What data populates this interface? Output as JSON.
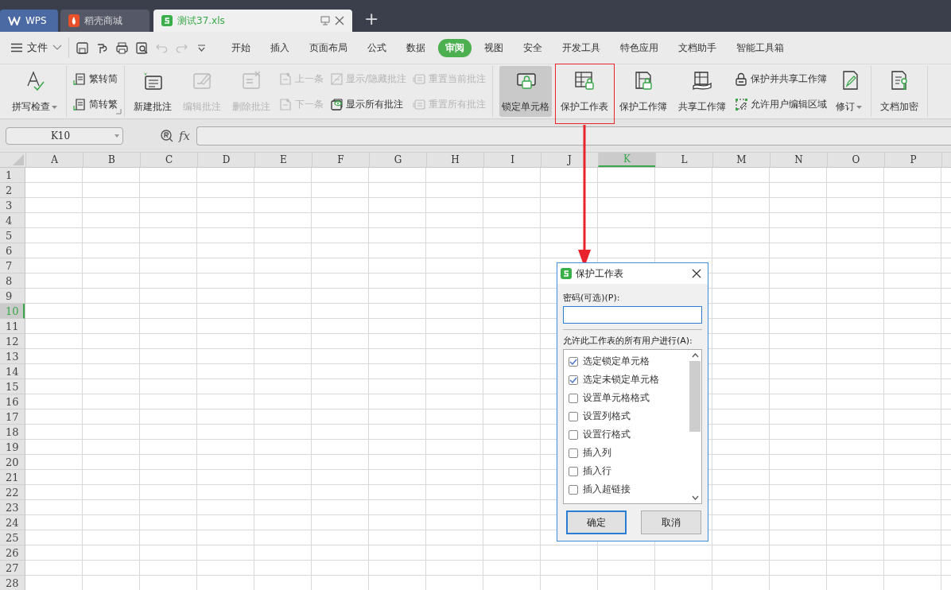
{
  "tabs": [
    {
      "label": "WPS",
      "kind": "home",
      "selected": false
    },
    {
      "label": "稻壳商城",
      "kind": "store",
      "selected": false
    },
    {
      "label": "测试37.xls",
      "kind": "sheet",
      "selected": true
    }
  ],
  "add_tab": "+",
  "menu": {
    "file": "文件",
    "items": [
      {
        "label": "开始",
        "selected": false
      },
      {
        "label": "插入",
        "selected": false
      },
      {
        "label": "页面布局",
        "selected": false
      },
      {
        "label": "公式",
        "selected": false
      },
      {
        "label": "数据",
        "selected": false
      },
      {
        "label": "审阅",
        "selected": true
      },
      {
        "label": "视图",
        "selected": false
      },
      {
        "label": "安全",
        "selected": false
      },
      {
        "label": "开发工具",
        "selected": false
      },
      {
        "label": "特色应用",
        "selected": false
      },
      {
        "label": "文档助手",
        "selected": false
      },
      {
        "label": "智能工具箱",
        "selected": false
      }
    ]
  },
  "ribbon": {
    "groups": [
      {
        "columns": [
          {
            "kind": "large",
            "buttons": [
              {
                "label": "拼写检查",
                "disabled": false,
                "pressed": false,
                "dropdown": true
              }
            ]
          }
        ]
      },
      {
        "launcher": true,
        "columns": [
          {
            "kind": "stack",
            "buttons": [
              {
                "label": "繁转简",
                "disabled": false,
                "pressed": false,
                "dropdown": false
              },
              {
                "label": "简转繁",
                "disabled": false,
                "pressed": false,
                "dropdown": false
              }
            ]
          }
        ]
      },
      {
        "columns": [
          {
            "kind": "large",
            "buttons": [
              {
                "label": "新建批注",
                "disabled": false,
                "pressed": false,
                "dropdown": false
              }
            ]
          },
          {
            "kind": "large",
            "buttons": [
              {
                "label": "编辑批注",
                "disabled": true,
                "pressed": false,
                "dropdown": false
              }
            ]
          },
          {
            "kind": "large",
            "buttons": [
              {
                "label": "删除批注",
                "disabled": true,
                "pressed": false,
                "dropdown": false
              }
            ]
          },
          {
            "kind": "stack",
            "buttons": [
              {
                "label": "上一条",
                "disabled": true,
                "pressed": false,
                "dropdown": false
              },
              {
                "label": "下一条",
                "disabled": true,
                "pressed": false,
                "dropdown": false
              }
            ]
          },
          {
            "kind": "stack",
            "buttons": [
              {
                "label": "显示/隐藏批注",
                "disabled": true,
                "pressed": false,
                "dropdown": false
              },
              {
                "label": "显示所有批注",
                "disabled": false,
                "pressed": false,
                "dropdown": false
              }
            ]
          },
          {
            "kind": "stack",
            "buttons": [
              {
                "label": "重置当前批注",
                "disabled": true,
                "pressed": false,
                "dropdown": false
              },
              {
                "label": "重置所有批注",
                "disabled": true,
                "pressed": false,
                "dropdown": false
              }
            ]
          }
        ]
      },
      {
        "columns": [
          {
            "kind": "large",
            "buttons": [
              {
                "label": "锁定单元格",
                "disabled": false,
                "pressed": true,
                "dropdown": false
              }
            ]
          },
          {
            "kind": "large",
            "buttons": [
              {
                "label": "保护工作表",
                "disabled": false,
                "pressed": false,
                "dropdown": false
              }
            ]
          },
          {
            "kind": "large",
            "buttons": [
              {
                "label": "保护工作簿",
                "disabled": false,
                "pressed": false,
                "dropdown": false
              }
            ]
          },
          {
            "kind": "large",
            "buttons": [
              {
                "label": "共享工作簿",
                "disabled": false,
                "pressed": false,
                "dropdown": false
              }
            ]
          },
          {
            "kind": "stack",
            "buttons": [
              {
                "label": "保护并共享工作簿",
                "disabled": false,
                "pressed": false,
                "dropdown": false
              },
              {
                "label": "允许用户编辑区域",
                "disabled": false,
                "pressed": false,
                "dropdown": false
              }
            ]
          },
          {
            "kind": "large",
            "buttons": [
              {
                "label": "修订",
                "disabled": false,
                "pressed": false,
                "dropdown": true
              }
            ]
          }
        ]
      },
      {
        "columns": [
          {
            "kind": "large",
            "buttons": [
              {
                "label": "文档加密",
                "disabled": false,
                "pressed": false,
                "dropdown": false
              }
            ]
          }
        ]
      }
    ]
  },
  "formula_bar": {
    "name_box": "K10",
    "fx": "fx"
  },
  "sheet": {
    "columns": [
      {
        "label": "A",
        "selected": false
      },
      {
        "label": "B",
        "selected": false
      },
      {
        "label": "C",
        "selected": false
      },
      {
        "label": "D",
        "selected": false
      },
      {
        "label": "E",
        "selected": false
      },
      {
        "label": "F",
        "selected": false
      },
      {
        "label": "G",
        "selected": false
      },
      {
        "label": "H",
        "selected": false
      },
      {
        "label": "I",
        "selected": false
      },
      {
        "label": "J",
        "selected": false
      },
      {
        "label": "K",
        "selected": true
      },
      {
        "label": "L",
        "selected": false
      },
      {
        "label": "M",
        "selected": false
      },
      {
        "label": "N",
        "selected": false
      },
      {
        "label": "O",
        "selected": false
      },
      {
        "label": "P",
        "selected": false
      }
    ],
    "rows": [
      {
        "label": "1",
        "selected": false
      },
      {
        "label": "2",
        "selected": false
      },
      {
        "label": "3",
        "selected": false
      },
      {
        "label": "4",
        "selected": false
      },
      {
        "label": "5",
        "selected": false
      },
      {
        "label": "6",
        "selected": false
      },
      {
        "label": "7",
        "selected": false
      },
      {
        "label": "8",
        "selected": false
      },
      {
        "label": "9",
        "selected": false
      },
      {
        "label": "10",
        "selected": true
      },
      {
        "label": "11",
        "selected": false
      },
      {
        "label": "12",
        "selected": false
      },
      {
        "label": "13",
        "selected": false
      },
      {
        "label": "14",
        "selected": false
      },
      {
        "label": "15",
        "selected": false
      },
      {
        "label": "16",
        "selected": false
      },
      {
        "label": "17",
        "selected": false
      },
      {
        "label": "18",
        "selected": false
      },
      {
        "label": "19",
        "selected": false
      },
      {
        "label": "20",
        "selected": false
      },
      {
        "label": "21",
        "selected": false
      },
      {
        "label": "22",
        "selected": false
      },
      {
        "label": "23",
        "selected": false
      },
      {
        "label": "24",
        "selected": false
      },
      {
        "label": "25",
        "selected": false
      },
      {
        "label": "26",
        "selected": false
      },
      {
        "label": "27",
        "selected": false
      },
      {
        "label": "28",
        "selected": false
      }
    ]
  },
  "dialog": {
    "title": "保护工作表",
    "password_label": "密码(可选)(P):",
    "allow_label": "允许此工作表的所有用户进行(A):",
    "options": [
      {
        "label": "选定锁定单元格",
        "checked": true
      },
      {
        "label": "选定未锁定单元格",
        "checked": true
      },
      {
        "label": "设置单元格格式",
        "checked": false
      },
      {
        "label": "设置列格式",
        "checked": false
      },
      {
        "label": "设置行格式",
        "checked": false
      },
      {
        "label": "插入列",
        "checked": false
      },
      {
        "label": "插入行",
        "checked": false
      },
      {
        "label": "插入超链接",
        "checked": false
      }
    ],
    "buttons": [
      {
        "label": "确定",
        "default": true
      },
      {
        "label": "取消",
        "default": false
      }
    ]
  }
}
